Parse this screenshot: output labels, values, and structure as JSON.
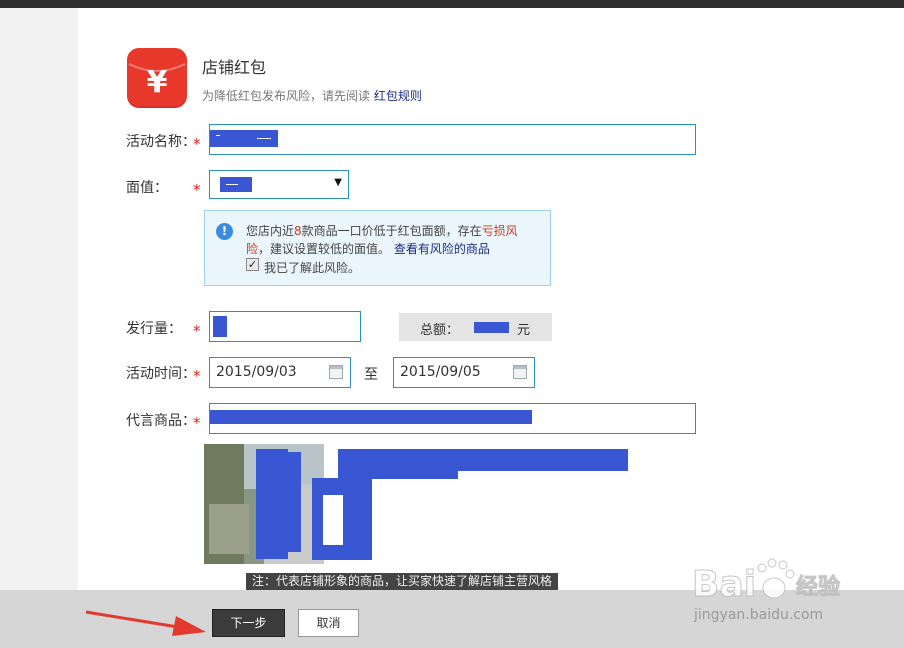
{
  "header": {
    "title": "店铺红包",
    "subtitle_text": "为降低红包发布风险，请先阅读",
    "rules_link": "红包规则",
    "logo_glyph": "¥"
  },
  "form": {
    "required_mark": "*",
    "name_label": "活动名称：",
    "value_label": "面值：",
    "select_arrow": "▼",
    "quantity_label": "发行量：",
    "total_label": "总额：",
    "total_unit": "元",
    "time_label": "活动时间：",
    "start_date": "2015/09/03",
    "end_date": "2015/09/05",
    "to_label": "至",
    "product_label": "代言商品："
  },
  "notice": {
    "icon_glyph": "!",
    "line1_prefix": "您店内近",
    "count": "8",
    "line1_mid": "款商品一口价低于红包面额，存在",
    "loss_a": "亏损风",
    "loss_b": "险",
    "line2_mid": "，建议设置较低的面值。",
    "risk_link": "查看有风险的商品",
    "checkbox_mark": "✓",
    "checkbox_label": "我已了解此风险。",
    "checkbox_checked": true
  },
  "product": {
    "caption": "注：代表店铺形象的商品，让买家快速了解店铺主营风格"
  },
  "footer": {
    "next_label": "下一步",
    "cancel_label": "取消"
  },
  "watermark": {
    "logo": "Bai",
    "logo_cn": "经验",
    "url": "jingyan.baidu.com"
  },
  "colors": {
    "brand_red": "#e8382b",
    "field_border": "#2b8fc3",
    "required": "#d9251c",
    "link": "#1f2a80",
    "redaction": "#3a57d3"
  }
}
